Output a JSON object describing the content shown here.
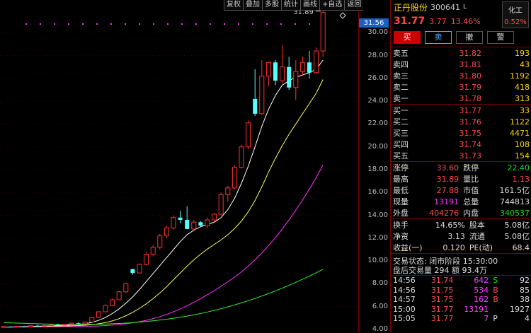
{
  "toolbar": {
    "items": [
      "复权",
      "叠加",
      "多股",
      "统计",
      "画线",
      "+自选",
      "返回"
    ]
  },
  "stock": {
    "name": "正丹股份",
    "code": "300641",
    "flag": "L",
    "price": "31.77",
    "change": "3.77",
    "pct": "13.46%"
  },
  "category": {
    "name": "化工",
    "pct": "0.52%"
  },
  "buttons": {
    "buy": "买",
    "sell": "卖",
    "cancel": "撤",
    "alert": "警"
  },
  "asks": [
    {
      "label": "卖五",
      "price": "31.82",
      "vol": "193"
    },
    {
      "label": "卖四",
      "price": "31.81",
      "vol": "43"
    },
    {
      "label": "卖三",
      "price": "31.80",
      "vol": "1192"
    },
    {
      "label": "卖二",
      "price": "31.79",
      "vol": "418"
    },
    {
      "label": "卖一",
      "price": "31.78",
      "vol": "313"
    }
  ],
  "bids": [
    {
      "label": "买一",
      "price": "31.77",
      "vol": "33"
    },
    {
      "label": "买二",
      "price": "31.76",
      "vol": "1122"
    },
    {
      "label": "买三",
      "price": "31.75",
      "vol": "4471"
    },
    {
      "label": "买四",
      "price": "31.74",
      "vol": "108"
    },
    {
      "label": "买五",
      "price": "31.73",
      "vol": "154"
    }
  ],
  "stats": [
    {
      "l1": "涨停",
      "v1": "33.60",
      "l2": "跌停",
      "v2": "22.40",
      "c1": "r",
      "c2": "g"
    },
    {
      "l1": "最高",
      "v1": "31.89",
      "l2": "量比",
      "v2": "1.13",
      "c1": "r",
      "c2": "r"
    },
    {
      "l1": "最低",
      "v1": "27.88",
      "l2": "市值",
      "v2": "161.5亿",
      "c1": "r",
      "c2": "w"
    },
    {
      "l1": "现量",
      "v1": "13191",
      "l2": "总量",
      "v2": "744813",
      "c1": "m",
      "c2": "w"
    },
    {
      "l1": "外盘",
      "v1": "404276",
      "l2": "内盘",
      "v2": "340537",
      "c1": "r",
      "c2": "g"
    }
  ],
  "stats2": [
    {
      "l1": "换手",
      "v1": "14.65%",
      "l2": "股本",
      "v2": "5.08亿"
    },
    {
      "l1": "净资",
      "v1": "3.13",
      "l2": "流通",
      "v2": "5.08亿"
    },
    {
      "l1": "收益(一)",
      "v1": "0.120",
      "l2": "PE(动)",
      "v2": "68.4"
    }
  ],
  "status": {
    "line1": "交易状态: 闭市阶段 15:30:00",
    "line2": "盘后交易量 294 额 93.4万"
  },
  "ticks": [
    {
      "t": "14:56",
      "p": "31.74",
      "v": "642",
      "bs": "S",
      "n": "92",
      "bsc": "g"
    },
    {
      "t": "14:56",
      "p": "31.75",
      "v": "534",
      "bs": "B",
      "n": "85",
      "bsc": "r"
    },
    {
      "t": "14:57",
      "p": "31.75",
      "v": "162",
      "bs": "B",
      "n": "38",
      "bsc": "r"
    },
    {
      "t": "15:00",
      "p": "31.77",
      "v": "13191",
      "bs": "",
      "n": "1927",
      "bsc": "w"
    },
    {
      "t": "15:05",
      "p": "31.77",
      "v": "7",
      "bs": "P",
      "n": "4",
      "bsc": "w"
    }
  ],
  "chart_data": {
    "type": "candlestick",
    "ylim": [
      4,
      32
    ],
    "y_ticks": [
      "30.00",
      "28.00",
      "26.00",
      "24.00",
      "22.00",
      "20.00",
      "18.00",
      "16.00",
      "14.00",
      "12.00",
      "10.00",
      "8.00",
      "6.00",
      "4.00"
    ],
    "current_price_tag": "31.56",
    "high_label": "31.89",
    "candles": [
      [
        4.2,
        4.3,
        4.15,
        4.25
      ],
      [
        4.25,
        4.28,
        4.18,
        4.22
      ],
      [
        4.22,
        4.3,
        4.2,
        4.27
      ],
      [
        4.27,
        4.32,
        4.22,
        4.24
      ],
      [
        4.24,
        4.35,
        4.22,
        4.33
      ],
      [
        4.33,
        4.4,
        4.28,
        4.3
      ],
      [
        4.3,
        4.38,
        4.26,
        4.36
      ],
      [
        4.36,
        4.45,
        4.32,
        4.4
      ],
      [
        4.4,
        4.5,
        4.35,
        4.38
      ],
      [
        4.38,
        4.46,
        4.33,
        4.45
      ],
      [
        4.45,
        4.6,
        4.4,
        4.55
      ],
      [
        4.55,
        4.62,
        4.48,
        4.5
      ],
      [
        4.5,
        4.7,
        4.48,
        4.65
      ],
      [
        4.65,
        5.1,
        4.62,
        5.05
      ],
      [
        5.05,
        5.6,
        5.0,
        5.55
      ],
      [
        5.55,
        6.2,
        5.5,
        6.1
      ],
      [
        6.1,
        6.7,
        6.05,
        6.6
      ],
      [
        6.6,
        7.4,
        6.55,
        7.3
      ],
      [
        7.3,
        8.1,
        7.2,
        8.0
      ],
      [
        9.3,
        9.2,
        8.8,
        8.95
      ],
      [
        8.95,
        9.8,
        8.9,
        9.7
      ],
      [
        9.7,
        10.8,
        9.6,
        10.6
      ],
      [
        10.6,
        11.4,
        10.4,
        11.2
      ],
      [
        11.2,
        12.4,
        11.0,
        12.2
      ],
      [
        12.2,
        13.1,
        12.0,
        12.9
      ],
      [
        12.9,
        14.0,
        12.7,
        13.8
      ],
      [
        13.8,
        14.4,
        13.3,
        13.6
      ],
      [
        13.6,
        14.8,
        12.9,
        12.8
      ],
      [
        12.8,
        13.6,
        12.6,
        13.4
      ],
      [
        13.4,
        13.5,
        13.0,
        13.1
      ],
      [
        13.1,
        13.8,
        12.9,
        13.6
      ],
      [
        13.6,
        14.2,
        13.4,
        14.1
      ],
      [
        14.1,
        16.0,
        14.0,
        15.8
      ],
      [
        15.8,
        16.6,
        15.2,
        16.4
      ],
      [
        16.4,
        18.4,
        16.3,
        18.2
      ],
      [
        18.2,
        20.2,
        18.1,
        20.0
      ],
      [
        20.0,
        22.3,
        19.8,
        22.1
      ],
      [
        24.2,
        26.8,
        22.7,
        22.9
      ],
      [
        22.9,
        27.6,
        22.8,
        26.2
      ],
      [
        26.2,
        27.5,
        25.3,
        27.4
      ],
      [
        27.4,
        27.6,
        25.4,
        25.8
      ],
      [
        25.8,
        28.9,
        25.6,
        27.0
      ],
      [
        27.0,
        27.9,
        25.0,
        25.2
      ],
      [
        25.2,
        27.6,
        24.1,
        26.6
      ],
      [
        26.6,
        27.9,
        26.2,
        27.4
      ],
      [
        27.4,
        28.4,
        26.0,
        26.5
      ],
      [
        26.5,
        28.7,
        26.4,
        28.4
      ],
      [
        28.4,
        31.89,
        27.88,
        31.77
      ]
    ],
    "ma_lines": [
      {
        "color": "#ffffff",
        "values": [
          4.2,
          4.22,
          4.24,
          4.25,
          4.26,
          4.28,
          4.3,
          4.32,
          4.34,
          4.36,
          4.4,
          4.44,
          4.5,
          4.62,
          4.8,
          5.05,
          5.4,
          5.8,
          6.3,
          6.85,
          7.5,
          8.2,
          8.9,
          9.6,
          10.3,
          11.0,
          11.7,
          12.3,
          12.7,
          13.0,
          13.2,
          13.4,
          13.8,
          14.5,
          15.5,
          16.8,
          18.3,
          20.0,
          21.8,
          23.3,
          24.5,
          25.4,
          25.8,
          26.1,
          26.3,
          26.5,
          26.8,
          27.6
        ]
      },
      {
        "color": "#ffff55",
        "values": [
          4.2,
          4.21,
          4.22,
          4.23,
          4.24,
          4.25,
          4.26,
          4.27,
          4.28,
          4.3,
          4.32,
          4.34,
          4.37,
          4.42,
          4.5,
          4.6,
          4.75,
          4.95,
          5.2,
          5.5,
          5.85,
          6.25,
          6.7,
          7.2,
          7.75,
          8.35,
          8.95,
          9.55,
          10.1,
          10.6,
          11.05,
          11.45,
          11.85,
          12.3,
          12.85,
          13.5,
          14.3,
          15.3,
          16.5,
          17.8,
          19.0,
          20.1,
          21.1,
          22.0,
          22.9,
          23.8,
          24.7,
          25.9
        ]
      },
      {
        "color": "#ff33ff",
        "values": [
          4.2,
          4.2,
          4.21,
          4.21,
          4.22,
          4.22,
          4.23,
          4.23,
          4.24,
          4.24,
          4.25,
          4.26,
          4.27,
          4.29,
          4.31,
          4.34,
          4.38,
          4.43,
          4.5,
          4.58,
          4.68,
          4.8,
          4.95,
          5.12,
          5.32,
          5.55,
          5.8,
          6.08,
          6.38,
          6.7,
          7.05,
          7.4,
          7.78,
          8.18,
          8.6,
          9.05,
          9.55,
          10.1,
          10.7,
          11.35,
          12.05,
          12.8,
          13.6,
          14.45,
          15.35,
          16.3,
          17.3,
          18.4
        ]
      },
      {
        "color": "#33ee33",
        "values": [
          4.6,
          4.58,
          4.56,
          4.54,
          4.52,
          4.5,
          4.48,
          4.47,
          4.46,
          4.45,
          4.44,
          4.44,
          4.44,
          4.45,
          4.46,
          4.48,
          4.5,
          4.53,
          4.56,
          4.6,
          4.65,
          4.7,
          4.76,
          4.83,
          4.9,
          4.98,
          5.07,
          5.17,
          5.28,
          5.4,
          5.53,
          5.67,
          5.82,
          5.98,
          6.15,
          6.33,
          6.52,
          6.72,
          6.93,
          7.15,
          7.38,
          7.62,
          7.87,
          8.13,
          8.4,
          8.68,
          8.97,
          9.27
        ]
      }
    ]
  }
}
